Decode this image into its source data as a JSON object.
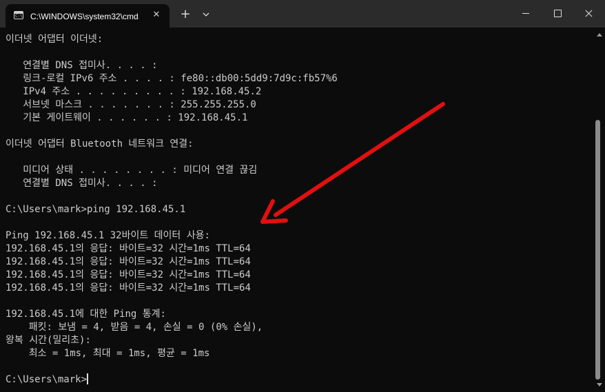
{
  "window": {
    "tab_title": "C:\\WINDOWS\\system32\\cmd.exe",
    "tab_icon": "terminal-icon",
    "tab_icon_text": "C:\\",
    "close_tab_symbol": "✕",
    "new_tab_symbol": "+",
    "dropdown_icon": "chevron-down-icon",
    "controls": [
      "minimize-icon",
      "maximize-icon",
      "close-icon"
    ]
  },
  "terminal": {
    "lines": [
      "이더넷 어댑터 이더넷:",
      "",
      "   연결별 DNS 접미사. . . . :",
      "   링크-로컬 IPv6 주소 . . . . : fe80::db00:5dd9:7d9c:fb57%6",
      "   IPv4 주소 . . . . . . . . . : 192.168.45.2",
      "   서브넷 마스크 . . . . . . . : 255.255.255.0",
      "   기본 게이트웨이 . . . . . . : 192.168.45.1",
      "",
      "이더넷 어댑터 Bluetooth 네트워크 연결:",
      "",
      "   미디어 상태 . . . . . . . . : 미디어 연결 끊김",
      "   연결별 DNS 접미사. . . . :",
      "",
      "C:\\Users\\mark>ping 192.168.45.1",
      "",
      "Ping 192.168.45.1 32바이트 데이터 사용:",
      "192.168.45.1의 응답: 바이트=32 시간=1ms TTL=64",
      "192.168.45.1의 응답: 바이트=32 시간=1ms TTL=64",
      "192.168.45.1의 응답: 바이트=32 시간=1ms TTL=64",
      "192.168.45.1의 응답: 바이트=32 시간=1ms TTL=64",
      "",
      "192.168.45.1에 대한 Ping 통계:",
      "    패킷: 보냄 = 4, 받음 = 4, 손실 = 0 (0% 손실),",
      "왕복 시간(밀리초):",
      "    최소 = 1ms, 최대 = 1ms, 평균 = 1ms",
      ""
    ],
    "prompt": "C:\\Users\\mark>",
    "text_color": "#cccccc",
    "background": "#0c0c0c"
  },
  "annotation": {
    "type": "arrow",
    "color": "#e01010"
  }
}
